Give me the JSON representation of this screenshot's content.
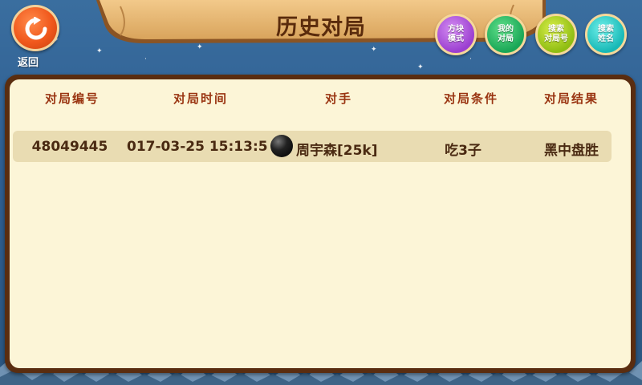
{
  "header": {
    "title": "历史对局",
    "back_label": "返回"
  },
  "actions": [
    {
      "label": "方块模式",
      "line1": "方块",
      "line2": "模式",
      "color": "#b25be0"
    },
    {
      "label": "我的对局",
      "line1": "我的",
      "line2": "对局",
      "color": "#23b45e"
    },
    {
      "label": "搜索对局号",
      "line1": "搜索",
      "line2": "对局号",
      "color": "#a7cf1e"
    },
    {
      "label": "搜索姓名",
      "line1": "搜索",
      "line2": "姓名",
      "color": "#22c3c1"
    }
  ],
  "table": {
    "columns": [
      "对局编号",
      "对局时间",
      "对手",
      "对局条件",
      "对局结果"
    ],
    "rows": [
      {
        "game_id": "48049445",
        "time": "017-03-25 15:13:5",
        "opponent": "周宇森[25k]",
        "stone_color": "black",
        "condition": "吃3子",
        "result": "黑中盘胜"
      }
    ]
  },
  "colors": {
    "accent_orange": "#f0581c",
    "panel_border": "#5a2d10",
    "panel_bg": "#fcf5d7",
    "header_text": "#9a3512"
  }
}
